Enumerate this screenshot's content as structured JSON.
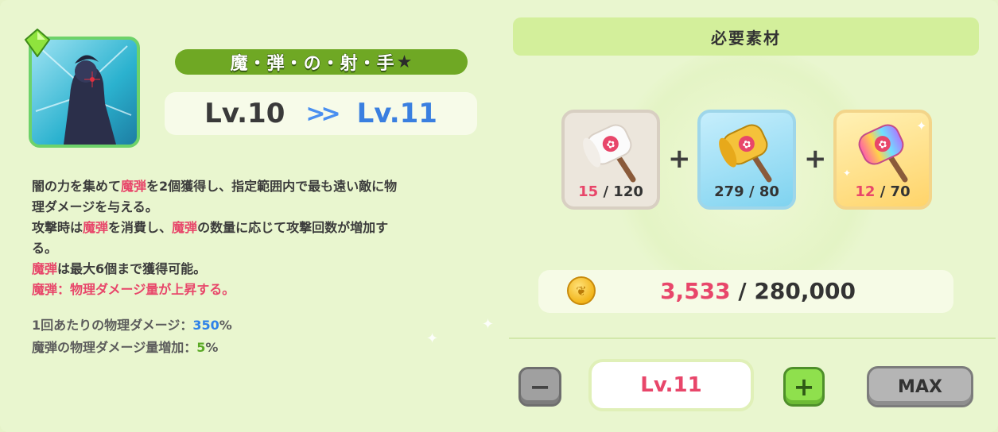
{
  "skill": {
    "name": "魔・弾・の・射・手",
    "name_star": "★",
    "level_from": "Lv.10",
    "level_arrow": ">>",
    "level_to": "Lv.11"
  },
  "description": {
    "l1_a": "闇の力を集めて",
    "l1_hl": "魔弾",
    "l1_b": "を2個獲得し、指定範囲内で最も遠い敵に物",
    "l2": "理ダメージを与える。",
    "l3_a": "攻撃時は",
    "l3_hl1": "魔弾",
    "l3_b": "を消費し、",
    "l3_hl2": "魔弾",
    "l3_c": "の数量に応じて攻撃回数が増加す",
    "l4": "る。",
    "l5_hl": "魔弾",
    "l5_b": "は最大6個まで獲得可能。",
    "l6": "魔弾：物理ダメージ量が上昇する。"
  },
  "stats": {
    "s1_label": "1回あたりの物理ダメージ：",
    "s1_value": "350",
    "s1_unit": "%",
    "s2_label": "魔弾の物理ダメージ量増加：",
    "s2_value": "5",
    "s2_unit": "%"
  },
  "materials": {
    "header": "必要素材",
    "items": [
      {
        "icon": "marshmallow-hammer-white-icon",
        "have": "15",
        "sep": " / ",
        "need": "120"
      },
      {
        "icon": "marshmallow-hammer-gold-icon",
        "have": "279",
        "sep": " / ",
        "need": "80"
      },
      {
        "icon": "marshmallow-hammer-rainbow-icon",
        "have": "12",
        "sep": " / ",
        "need": "70"
      }
    ],
    "plus": "+"
  },
  "gold": {
    "icon": "coin-icon",
    "have": "3,533",
    "sep": " / ",
    "need": "280,000"
  },
  "controls": {
    "minus_label": "−",
    "level_value": "Lv.11",
    "plus_label": "+",
    "max_label": "MAX"
  },
  "colors": {
    "background": "#e9f6cf",
    "accent_pink": "#e8466a",
    "accent_blue": "#2f82e8",
    "accent_green": "#5aa925",
    "name_bar": "#6fa824"
  }
}
